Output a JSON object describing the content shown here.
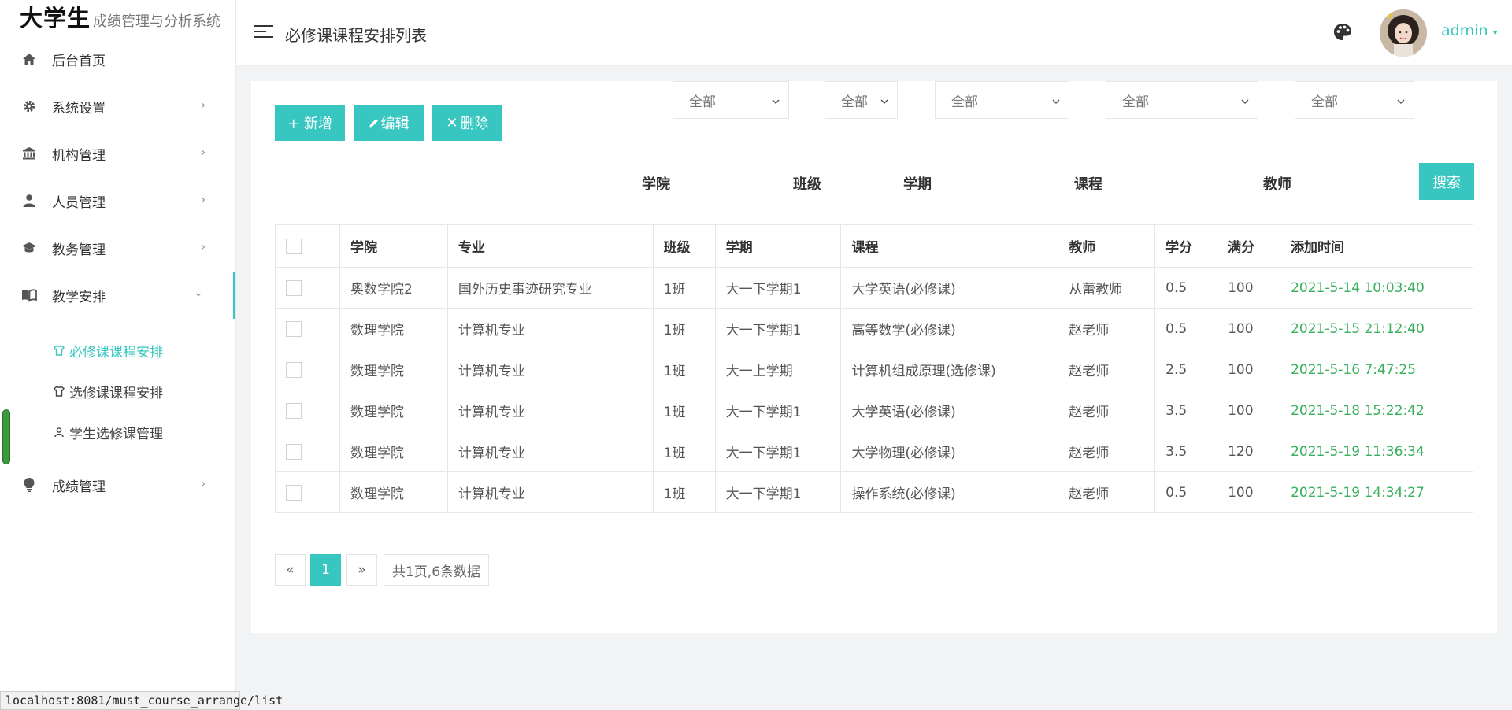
{
  "brand": {
    "main": "大学生",
    "sub": "成绩管理与分析系统"
  },
  "sidebar": {
    "items": [
      {
        "label": "后台首页",
        "icon": "home-icon"
      },
      {
        "label": "系统设置",
        "icon": "gear-icon"
      },
      {
        "label": "机构管理",
        "icon": "institution-icon"
      },
      {
        "label": "人员管理",
        "icon": "person-icon"
      },
      {
        "label": "教务管理",
        "icon": "graduation-cap-icon"
      },
      {
        "label": "教学安排",
        "icon": "book-open-icon"
      },
      {
        "label": "成绩管理",
        "icon": "bulb-icon"
      }
    ],
    "sub_items": [
      {
        "label": "必修课课程安排",
        "icon": "shirt-icon"
      },
      {
        "label": "选修课课程安排",
        "icon": "shirt-icon"
      },
      {
        "label": "学生选修课管理",
        "icon": "user-outline-icon"
      }
    ]
  },
  "header": {
    "title": "必修课课程安排列表",
    "user": "admin"
  },
  "toolbar": {
    "add": "+ 新增",
    "edit": "编辑",
    "delete": "删除"
  },
  "filters": {
    "college": {
      "label": "学院",
      "value": "全部"
    },
    "class": {
      "label": "班级",
      "value": "全部"
    },
    "term": {
      "label": "学期",
      "value": "全部"
    },
    "course": {
      "label": "课程",
      "value": "全部"
    },
    "teacher": {
      "label": "教师",
      "value": "全部"
    },
    "search": "搜索"
  },
  "table": {
    "headers": [
      "学院",
      "专业",
      "班级",
      "学期",
      "课程",
      "教师",
      "学分",
      "满分",
      "添加时间"
    ],
    "rows": [
      [
        "奥数学院2",
        "国外历史事迹研究专业",
        "1班",
        "大一下学期1",
        "大学英语(必修课)",
        "从蕾教师",
        "0.5",
        "100",
        "2021-5-14 10:03:40"
      ],
      [
        "数理学院",
        "计算机专业",
        "1班",
        "大一下学期1",
        "高等数学(必修课)",
        "赵老师",
        "0.5",
        "100",
        "2021-5-15 21:12:40"
      ],
      [
        "数理学院",
        "计算机专业",
        "1班",
        "大一上学期",
        "计算机组成原理(选修课)",
        "赵老师",
        "2.5",
        "100",
        "2021-5-16 7:47:25"
      ],
      [
        "数理学院",
        "计算机专业",
        "1班",
        "大一下学期1",
        "大学英语(必修课)",
        "赵老师",
        "3.5",
        "100",
        "2021-5-18 15:22:42"
      ],
      [
        "数理学院",
        "计算机专业",
        "1班",
        "大一下学期1",
        "大学物理(必修课)",
        "赵老师",
        "3.5",
        "120",
        "2021-5-19 11:36:34"
      ],
      [
        "数理学院",
        "计算机专业",
        "1班",
        "大一下学期1",
        "操作系统(必修课)",
        "赵老师",
        "0.5",
        "100",
        "2021-5-19 14:34:27"
      ]
    ]
  },
  "pagination": {
    "prev": "«",
    "current": "1",
    "next": "»",
    "summary": "共1页,6条数据"
  },
  "statusbar": {
    "url": "localhost:8081/must_course_arrange/list"
  },
  "colors": {
    "accent": "#37c6c0",
    "time": "#37b05c"
  }
}
